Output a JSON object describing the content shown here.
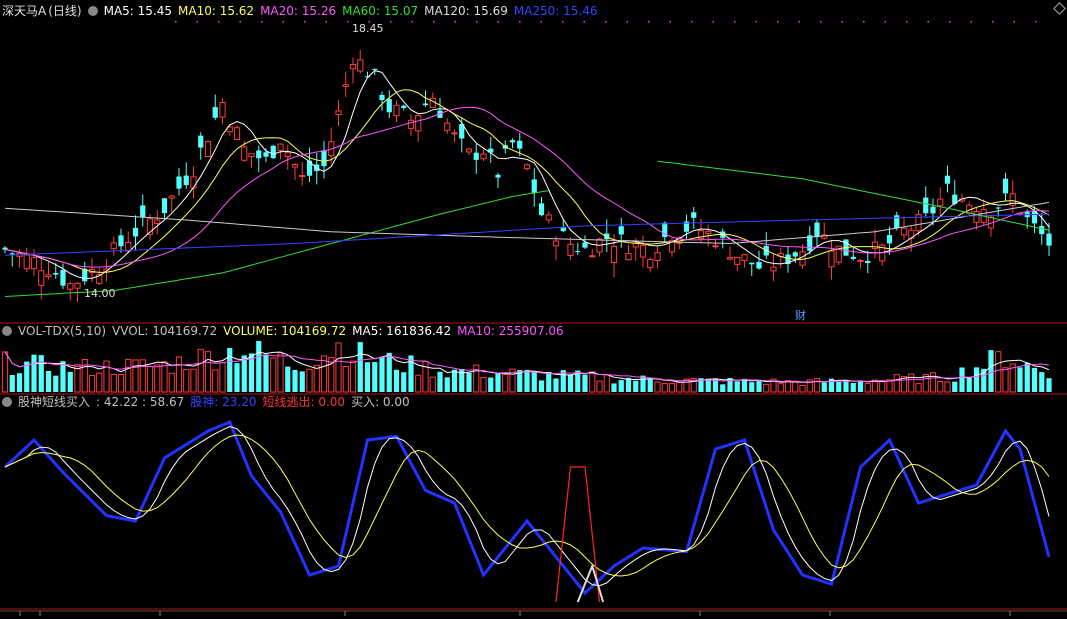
{
  "header": {
    "stock_name": "深天马A",
    "period": "(日线)",
    "ma5_label": "MA5: 15.45",
    "ma10_label": "MA10: 15.62",
    "ma20_label": "MA20: 15.26",
    "ma60_label": "MA60: 15.07",
    "ma120_label": "MA120: 15.69",
    "ma250_label": "MA250: 15.46"
  },
  "price_notes": {
    "high": "18.45",
    "low": "14.00",
    "finance_marker": "财"
  },
  "volume_header": {
    "indicator": "VOL-TDX(5,10)",
    "vvol": "VVOL: 104169.72",
    "volume": "VOLUME: 104169.72",
    "ma5": "MA5: 161836.42",
    "ma10": "MA10: 255907.06"
  },
  "osc_header": {
    "indicator": "股神短线买入",
    "values": ": 42.22 : 58.67",
    "gushen": "股神: 23.20",
    "exit": "短线逃出: 0.00",
    "buy": "买入: 0.00"
  },
  "colors": {
    "up": "#ff3b3b",
    "down": "#54ffff",
    "ma5": "#ffffff",
    "ma10": "#ffff55",
    "ma20": "#ff55ff",
    "ma60": "#33dd33",
    "ma120": "#cccccc",
    "ma250": "#3344ff",
    "gushen": "#2233ff",
    "exit": "#ff2222"
  },
  "chart_data": [
    {
      "type": "candlestick",
      "title": "深天马A (日线)",
      "y_range": [
        13.7,
        18.8
      ],
      "annotations": [
        {
          "label": "18.45",
          "value": 18.45
        },
        {
          "label": "14.00",
          "value": 14.0
        }
      ],
      "series_names": [
        "MA5",
        "MA10",
        "MA20",
        "MA60",
        "MA120",
        "MA250"
      ],
      "last_ma": {
        "MA5": 15.45,
        "MA10": 15.62,
        "MA20": 15.26,
        "MA60": 15.07,
        "MA120": 15.69,
        "MA250": 15.46
      }
    },
    {
      "type": "bar",
      "title": "VOL-TDX(5,10)",
      "last": {
        "VVOL": 104169.72,
        "VOLUME": 104169.72,
        "MA5": 161836.42,
        "MA10": 255907.06
      }
    },
    {
      "type": "line",
      "title": "股神短线买入",
      "last": {
        "a": 42.22,
        "b": 58.67,
        "股神": 23.2,
        "短线逃出": 0.0,
        "买入": 0.0
      }
    }
  ]
}
